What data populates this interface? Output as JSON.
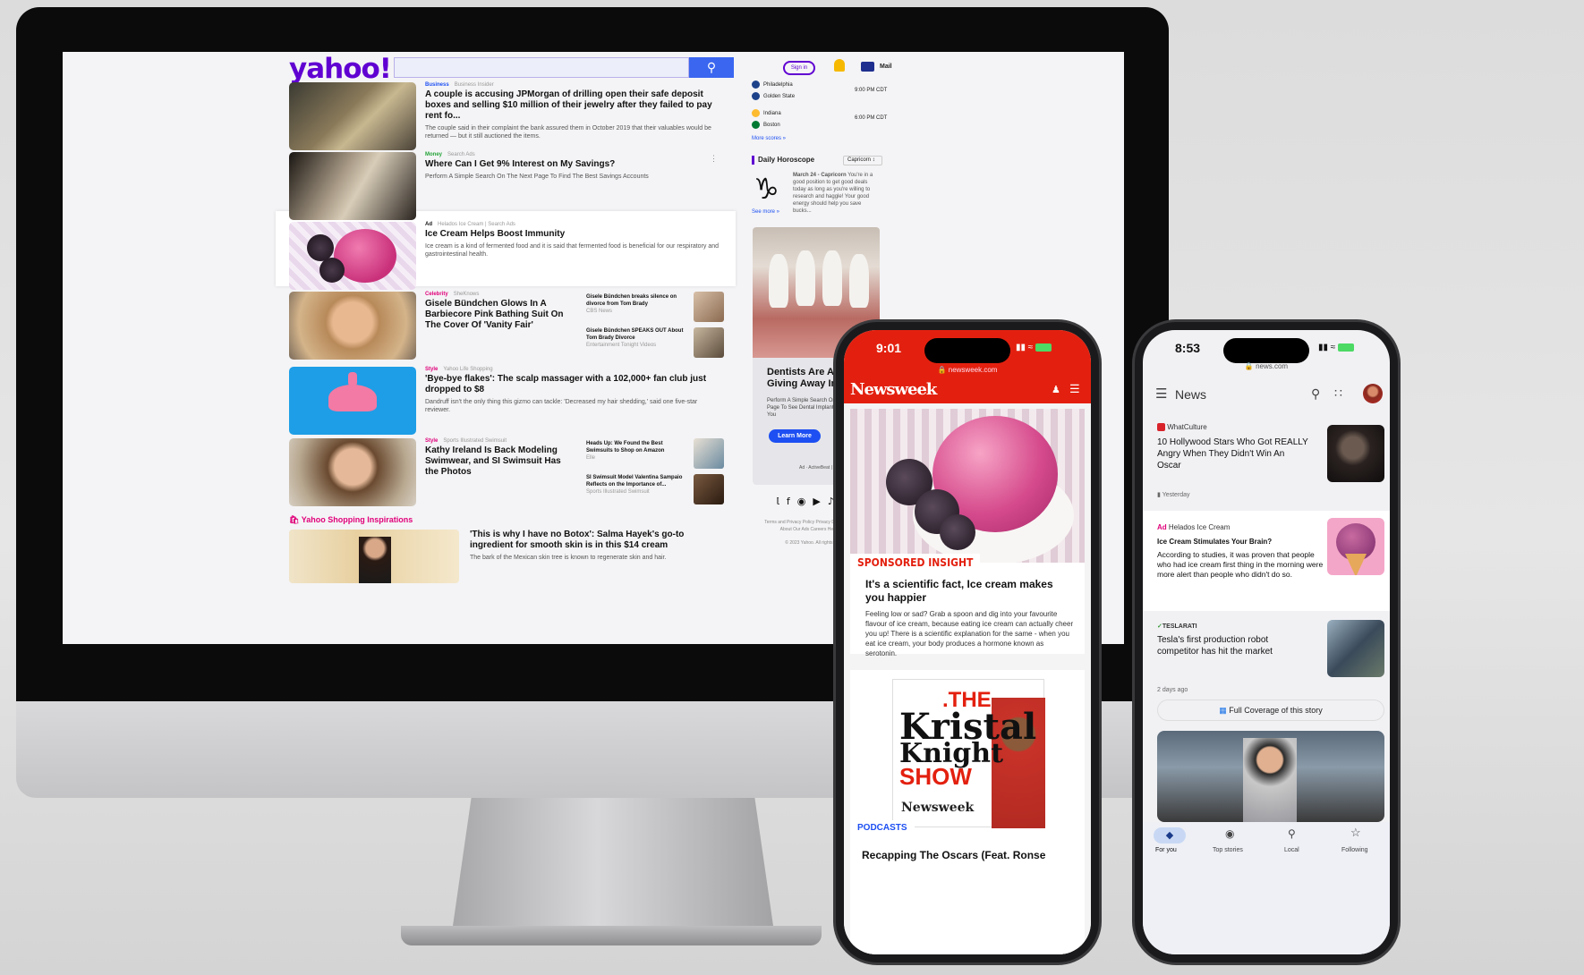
{
  "yahoo": {
    "logo": "yahoo!",
    "sign_in": "Sign in",
    "mail": "Mail",
    "stories": [
      {
        "category": "Business",
        "source": "Business Insider",
        "title": "A couple is accusing JPMorgan of drilling open their safe deposit boxes and selling $10 million of their jewelry after they failed to pay rent fo...",
        "desc": "The couple said in their complaint the bank assured them in October 2019 that their valuables would be returned — but it still auctioned the items.",
        "cat_color": "#1d4ff2"
      },
      {
        "category": "Money",
        "source": "Search Ads",
        "title": "Where Can I Get 9% Interest on My Savings?",
        "desc": "Perform A Simple Search On The Next Page To Find The Best Savings Accounts",
        "cat_color": "#25a33a"
      },
      {
        "category": "Ad",
        "source": "Helados Ice Cream | Search Ads",
        "title": "Ice Cream Helps Boost Immunity",
        "desc": "Ice cream is a kind of fermented food and it is said that fermented food is beneficial for our respiratory and gastrointestinal health.",
        "cat_color": "#111111"
      },
      {
        "category": "Celebrity",
        "source": "SheKnows",
        "title": "Gisele Bündchen Glows In A Barbiecore Pink Bathing Suit On The Cover Of 'Vanity Fair'",
        "desc": "",
        "cat_color": "#e0007a"
      },
      {
        "category": "Style",
        "source": "Yahoo Life Shopping",
        "title": "'Bye-bye flakes': The scalp massager with a 102,000+ fan club just dropped to $8",
        "desc": "Dandruff isn't the only thing this gizmo can tackle: 'Decreased my hair shedding,' said one five-star reviewer.",
        "cat_color": "#e0007a"
      },
      {
        "category": "Style",
        "source": "Sports Illustrated Swimsuit",
        "title": "Kathy Ireland Is Back Modeling Swimwear, and SI Swimsuit Has the Photos",
        "desc": "",
        "cat_color": "#e0007a"
      }
    ],
    "side_stories": [
      {
        "title": "Gisele Bündchen breaks silence on divorce from Tom Brady",
        "source": "CBS News"
      },
      {
        "title": "Gisele Bündchen SPEAKS OUT About Tom Brady Divorce",
        "source": "Entertainment Tonight Videos"
      },
      {
        "title": "Heads Up: We Found the Best Swimsuits to Shop on Amazon",
        "source": "Elle"
      },
      {
        "title": "SI Swimsuit Model Valentina Sampaio Reflects on the Importance of...",
        "source": "Sports Illustrated Swimsuit"
      }
    ],
    "shopping_label": "Yahoo Shopping Inspirations",
    "shopping_title": "'This is why I have no Botox': Salma Hayek's go-to ingredient for smooth skin is in this $14 cream",
    "shopping_desc": "The bark of the Mexican skin tree is known to regenerate skin and hair.",
    "scores": [
      {
        "team1": "Philadelphia",
        "team2": "Golden State",
        "time": "9:00 PM CDT"
      },
      {
        "team1": "Indiana",
        "team2": "Boston",
        "time": "6:00 PM CDT"
      }
    ],
    "more_scores": "More scores »",
    "horoscope_title": "Daily Horoscope",
    "horoscope_sign": "Capricorn",
    "horoscope_date": "March 24 - Capricorn",
    "horoscope_text": "You're in a good position to get good deals today as long as you're willing to research and haggle! Your good energy should help you save bucks...",
    "see_more": "See more »",
    "ad_title": "Dentists Are Almost Giving Away Implan...",
    "ad_desc": "Perform A Simple Search On The Next Page To See Dental Implant Prices Near You",
    "ad_button": "Learn More",
    "ad_source": "Ad · ActiveBeat | Search Ads",
    "footer_links": "Terms and Privacy Policy  Privacy Dashboard  Advertise  About Our Ads  Careers  Help  Feedback",
    "copyright": "© 2023 Yahoo. All rights reserved."
  },
  "newsweek": {
    "time": "9:01",
    "url": "newsweek.com",
    "brand": "Newsweek",
    "sponsored": "SPONSORED INSIGHT",
    "title": "It's a scientific fact, Ice cream makes you happier",
    "body": "Feeling low or sad? Grab a spoon and dig into your favourite flavour of ice cream, because eating ice cream can actually cheer you up! There is a scientific explanation for the same - when you eat ice cream, your body produces a hormone known as serotonin.",
    "podcast_the": ".THE",
    "podcast_name1": "Kristal",
    "podcast_name2": "Knight",
    "podcast_show": "SHOW",
    "podcast_brand": "Newsweek",
    "podcasts_label": "PODCASTS",
    "next_title": "Recapping The Oscars (Feat. Ronse"
  },
  "gnews": {
    "time": "8:53",
    "url": "news.com",
    "title": "News",
    "card1_source": "WhatCulture",
    "card1_title": "10 Hollywood Stars Who Got REALLY Angry When They Didn't Win An Oscar",
    "card1_time": "Yesterday",
    "ad_label": "Ad",
    "ad_source": "Helados Ice Cream",
    "ad_title": "Ice Cream Stimulates Your Brain?",
    "ad_body": "According to studies, it was proven that people who had ice cream first thing in the morning were more alert than people who didn't do so.",
    "card3_source": "TESLARATI",
    "card3_title": "Tesla's first production robot competitor has hit the market",
    "card3_time": "2 days ago",
    "full_coverage": "Full Coverage of this story",
    "nav": [
      "For you",
      "Top stories",
      "Local",
      "Following"
    ]
  }
}
